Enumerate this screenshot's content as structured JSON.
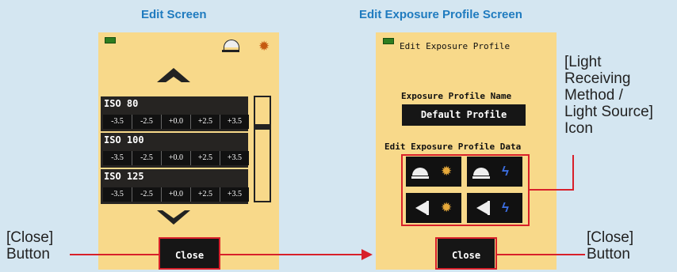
{
  "titles": {
    "left": "Edit Screen",
    "right": "Edit Exposure Profile Screen"
  },
  "edit_screen": {
    "rows": [
      {
        "iso": "ISO 80",
        "values": [
          "-3.5",
          "-2.5",
          "+0.0",
          "+2.5",
          "+3.5"
        ]
      },
      {
        "iso": "ISO 100",
        "values": [
          "-3.5",
          "-2.5",
          "+0.0",
          "+2.5",
          "+3.5"
        ]
      },
      {
        "iso": "ISO 125",
        "values": [
          "-3.5",
          "-2.5",
          "+0.0",
          "+2.5",
          "+3.5"
        ]
      }
    ],
    "close_label": "Close"
  },
  "profile_screen": {
    "header": "Edit Exposure Profile",
    "name_label": "Exposure Profile Name",
    "name_value": "Default Profile",
    "data_label": "Edit Exposure Profile Data",
    "close_label": "Close",
    "icons": [
      "dome-sun-icon",
      "dome-flash-icon",
      "spot-sun-icon",
      "spot-flash-icon"
    ]
  },
  "callouts": {
    "close_left": "[Close]\nButton",
    "close_right": "[Close]\nButton",
    "icon_method": "[Light\nReceiving\nMethod /\nLight Source]\nIcon"
  },
  "colors": {
    "screen_bg": "#f8d98a",
    "highlight": "#d8202a",
    "title_blue": "#1f7bbf"
  }
}
